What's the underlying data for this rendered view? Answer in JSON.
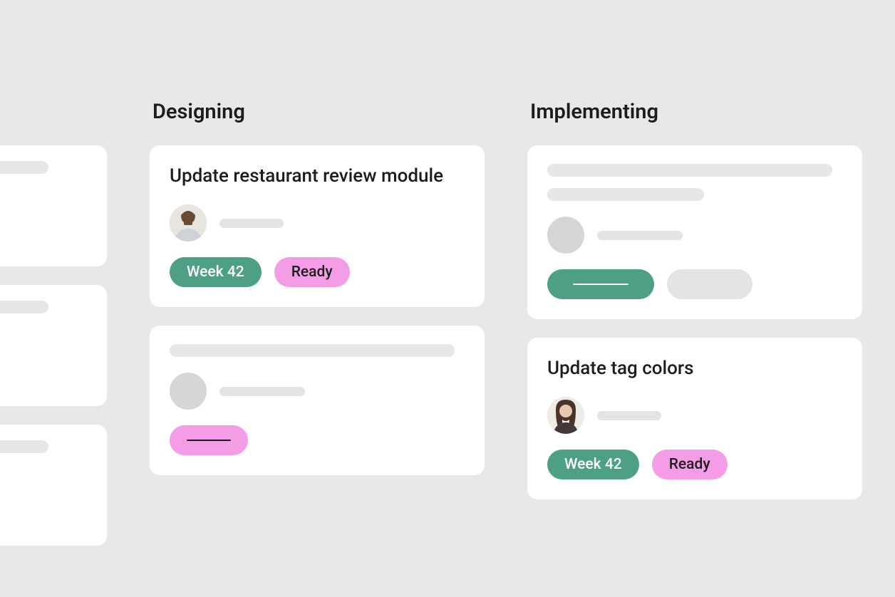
{
  "columns": {
    "designing": {
      "title": "Designing",
      "cards": [
        {
          "title": "Update restaurant review module",
          "pills": {
            "week": "Week 42",
            "status": "Ready"
          }
        }
      ]
    },
    "implementing": {
      "title": "Implementing",
      "cards": [
        {
          "title": "Update tag colors",
          "pills": {
            "week": "Week 42",
            "status": "Ready"
          }
        }
      ]
    }
  },
  "colors": {
    "pill_green": "#4da081",
    "pill_pink": "#f49ce6",
    "card_bg": "#ffffff",
    "page_bg": "#e9e8e6"
  }
}
